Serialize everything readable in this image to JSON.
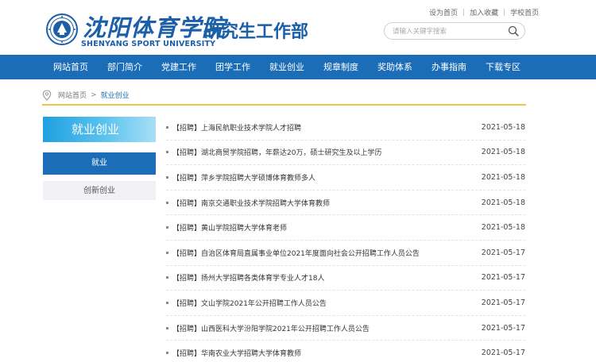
{
  "header": {
    "logo_cn": "沈阳体育学院",
    "logo_en": "SHENYANG SPORT UNIVERSITY",
    "site_title": "研究生工作部",
    "top_links": [
      "设为首页",
      "加入收藏",
      "学校首页"
    ],
    "search_placeholder": "请输入关键字搜索"
  },
  "nav": {
    "items": [
      "网站首页",
      "部门简介",
      "党建工作",
      "团学工作",
      "就业创业",
      "规章制度",
      "奖助体系",
      "办事指南",
      "下载专区"
    ]
  },
  "breadcrumb": {
    "home": "网站首页",
    "separator": ">",
    "current": "就业创业"
  },
  "sidebar": {
    "title": "就业创业",
    "items": [
      {
        "label": "就业",
        "active": true
      },
      {
        "label": "创新创业",
        "active": false
      }
    ]
  },
  "news": [
    {
      "title": "【招聘】上海民航职业技术学院人才招聘",
      "date": "2021-05-18"
    },
    {
      "title": "【招聘】湖北商贸学院招聘，年薪达20万，硕士研究生及以上学历",
      "date": "2021-05-18"
    },
    {
      "title": "【招聘】萍乡学院招聘大学硕博体育教师多人",
      "date": "2021-05-18"
    },
    {
      "title": "【招聘】南京交通职业技术学院招聘大学体育教师",
      "date": "2021-05-18"
    },
    {
      "title": "【招聘】黄山学院招聘大学体育老师",
      "date": "2021-05-18"
    },
    {
      "title": "【招聘】自治区体育局直属事业单位2021年度面向社会公开招聘工作人员公告",
      "date": "2021-05-17"
    },
    {
      "title": "【招聘】扬州大学招聘各类体育学专业人才18人",
      "date": "2021-05-17"
    },
    {
      "title": "【招聘】文山学院2021年公开招聘工作人员公告",
      "date": "2021-05-17"
    },
    {
      "title": "【招聘】山西医科大学汾阳学院2021年公开招聘工作人员公告",
      "date": "2021-05-17"
    },
    {
      "title": "【招聘】华南农业大学招聘大学体育教师",
      "date": "2021-05-17"
    }
  ],
  "colors": {
    "brand_blue": "#1c6db8",
    "accent_gold": "#f0c44c",
    "side_gradient_start": "#1fa0e0"
  }
}
